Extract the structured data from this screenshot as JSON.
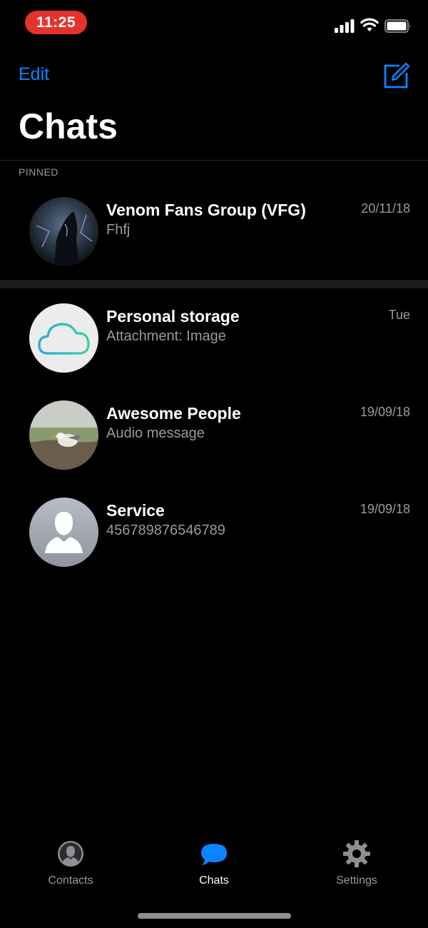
{
  "status_bar": {
    "time": "11:25",
    "time_pill_color": "#e5322d",
    "icons": [
      "cellular-signal-icon",
      "wifi-icon",
      "battery-icon"
    ]
  },
  "header": {
    "edit_label": "Edit",
    "compose_icon": "compose-icon",
    "title": "Chats",
    "accent_color": "#0a84ff"
  },
  "sections": {
    "pinned_label": "PINNED"
  },
  "chats": [
    {
      "name": "Venom Fans Group (VFG)",
      "preview": "Fhfj",
      "time": "20/11/18",
      "avatar": "venom-avatar",
      "pinned": true
    },
    {
      "name": "Personal storage",
      "preview": "Attachment: Image",
      "time": "Tue",
      "avatar": "cloud-avatar",
      "pinned": false
    },
    {
      "name": "Awesome People",
      "preview": "Audio message",
      "time": "19/09/18",
      "avatar": "seagull-avatar",
      "pinned": false
    },
    {
      "name": "Service",
      "preview": "456789876546789",
      "time": "19/09/18",
      "avatar": "person-placeholder-avatar",
      "pinned": false
    }
  ],
  "tab_bar": {
    "tabs": [
      {
        "label": "Contacts",
        "icon": "contacts-icon",
        "active": false
      },
      {
        "label": "Chats",
        "icon": "chat-bubble-icon",
        "active": true
      },
      {
        "label": "Settings",
        "icon": "gear-icon",
        "active": false
      }
    ]
  }
}
